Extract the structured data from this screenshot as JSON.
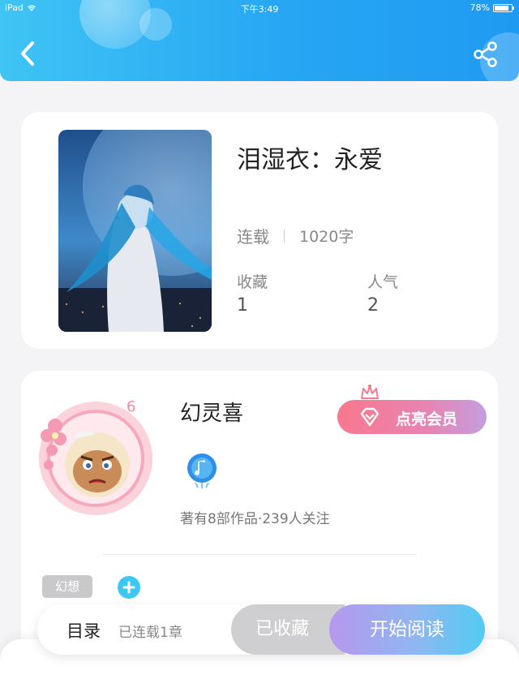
{
  "status_bar": {
    "device": "iPad",
    "time": "下午3:49",
    "battery": "78%"
  },
  "header": {
    "back_icon": "chevron-left-icon",
    "share_icon": "share-icon"
  },
  "book": {
    "title": "泪湿衣：永爱",
    "status": "连载",
    "word_count": "1020字",
    "stats": [
      {
        "label": "收藏",
        "value": "1"
      },
      {
        "label": "人气",
        "value": "2"
      }
    ]
  },
  "author": {
    "name": "幻灵喜",
    "level": "6",
    "vip_button": "点亮会员",
    "works_summary": "著有8部作品·239人关注",
    "tags": [
      "幻想"
    ]
  },
  "bottom_bar": {
    "toc_label": "目录",
    "chapters_label": "已连载1章",
    "collected_label": "已收藏",
    "read_label": "开始阅读"
  },
  "colors": {
    "header": "#27a6f3",
    "accent": "#3ec7f2",
    "vip": "#f8788e",
    "read_gradient_start": "#b697ec",
    "read_gradient_end": "#52cbf2"
  }
}
